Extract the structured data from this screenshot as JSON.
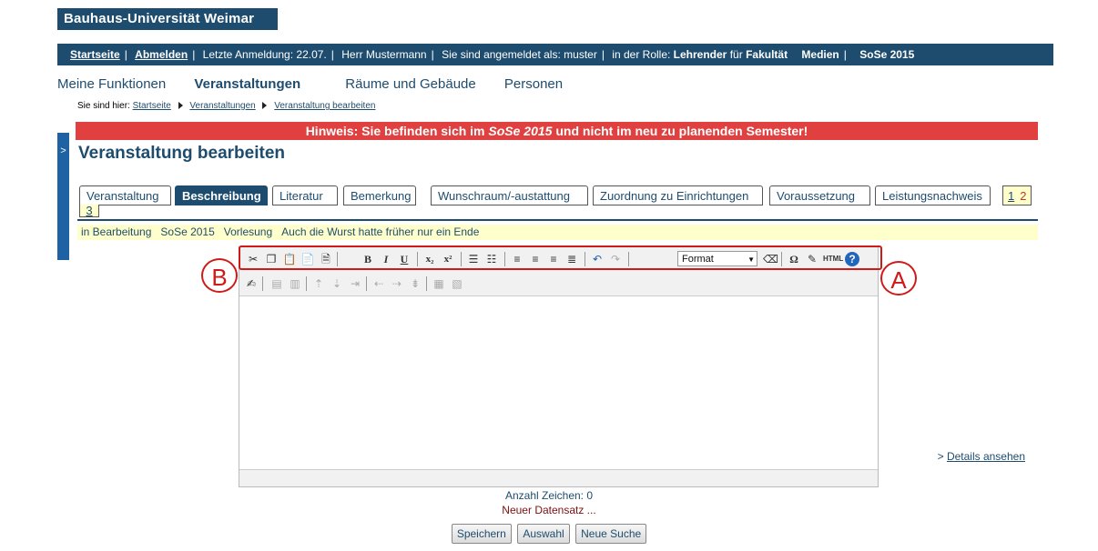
{
  "header": {
    "university": "Bauhaus-Universität Weimar"
  },
  "topbar": {
    "home": "Startseite",
    "logout": "Abmelden",
    "last_login": "Letzte Anmeldung: 22.07.",
    "user": "Herr Mustermann",
    "logged_in_as": "Sie sind angemeldet als: muster",
    "role_prefix": "in der Rolle:",
    "role": "Lehrender",
    "role_for": "für",
    "faculty_label": "Fakultät",
    "faculty": "Medien",
    "semester": "SoSe 2015"
  },
  "mainnav": {
    "items": [
      "Meine Funktionen",
      "Veranstaltungen",
      "Räume und Gebäude",
      "Personen"
    ],
    "active": "Veranstaltungen"
  },
  "breadcrumb": {
    "prefix": "Sie sind hier:",
    "items": [
      "Startseite",
      "Veranstaltungen",
      "Veranstaltung bearbeiten"
    ]
  },
  "leftbar": {
    "toggle": ">"
  },
  "hint": {
    "pre": "Hinweis: Sie befinden sich im ",
    "semester": "SoSe 2015",
    "post": " und nicht im neu zu planenden Semester!"
  },
  "page_title": "Veranstaltung bearbeiten",
  "tabs": [
    "Veranstaltung",
    "Beschreibung",
    "Literatur",
    "Bemerkung",
    "Wunschraum/-austattung",
    "Zuordnung zu Einrichtungen",
    "Voraussetzung",
    "Leistungsnachweis"
  ],
  "active_tab": "Beschreibung",
  "pages": [
    "1",
    "2",
    "3"
  ],
  "status": {
    "state": "in Bearbeitung",
    "semester": "SoSe 2015",
    "type": "Vorlesung",
    "title": "Auch die Wurst hatte früher nur ein Ende",
    "details_link": "Details ansehen",
    "details_prefix": ">"
  },
  "editor": {
    "format_label": "Format",
    "bold": "B",
    "italic": "I",
    "underline": "U",
    "subscript": "x₂",
    "superscript": "x²",
    "omega": "Ω",
    "html": "HTML",
    "help": "?"
  },
  "annotations": {
    "a": "A",
    "b": "B"
  },
  "footer": {
    "char_count": "Anzahl Zeichen: 0",
    "new_record": "Neuer Datensatz ...",
    "buttons": [
      "Speichern",
      "Auswahl",
      "Neue Suche"
    ]
  },
  "colors": {
    "brand": "#1e4c6e",
    "hint_bg": "#e0403f",
    "status_bg": "#ffffcc",
    "annotation": "#d01919"
  }
}
